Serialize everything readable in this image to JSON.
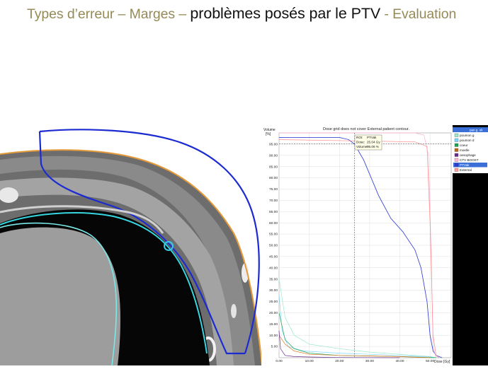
{
  "slide": {
    "title_prefix": "Types d’erreur – Marges – ",
    "title_main": "problèmes posés par le PTV",
    "title_suffix": " - Evaluation"
  },
  "dvh_window": {
    "warning": "Dose grid does not cover External patient contour.",
    "ylabel_line1": "Volume",
    "ylabel_line2": "[%]",
    "xlabel": "Dose [Gy]",
    "tooltip": {
      "roi_label": "ROI:",
      "roi_value": "PTVak",
      "dose_label": "Dose:",
      "dose_value": "25.04 Gy",
      "volume_label": "Volume:",
      "volume_value": "95.06 %"
    },
    "legend_header": "pan g. ok",
    "legend": [
      {
        "name": "poumon g",
        "color": "#9be9c9"
      },
      {
        "name": "poumon d",
        "color": "#7fd7ff"
      },
      {
        "name": "coeur",
        "color": "#22a055"
      },
      {
        "name": "moelle",
        "color": "#b36b18"
      },
      {
        "name": "oesophage",
        "color": "#6a2a8a"
      },
      {
        "name": "CTV BOOST",
        "color": "#ffb6d9"
      },
      {
        "name": "PTVak",
        "color": "#2a3be0",
        "selected": true
      },
      {
        "name": "External",
        "color": "#ff9e9e"
      }
    ]
  },
  "chart_data": {
    "type": "line",
    "xlabel": "Dose [Gy]",
    "ylabel": "Volume [%]",
    "xlim": [
      0,
      57
    ],
    "ylim": [
      0,
      100
    ],
    "x_ticks": [
      "0.00",
      "10.00",
      "20.00",
      "30.00",
      "40.00",
      "50.00"
    ],
    "y_ticks": [
      "5.00",
      "10.00",
      "15.00",
      "20.00",
      "25.00",
      "30.00",
      "35.00",
      "40.00",
      "45.00",
      "50.00",
      "55.00",
      "60.00",
      "65.00",
      "70.00",
      "75.00",
      "80.00",
      "85.00",
      "90.00",
      "95.00"
    ],
    "series": [
      {
        "name": "PTVak",
        "color": "#3a48d8",
        "x": [
          0,
          20,
          23,
          25,
          28,
          33,
          37,
          41,
          45,
          47,
          49,
          50,
          51,
          52,
          54
        ],
        "y": [
          98,
          98,
          97,
          95,
          88,
          72,
          62,
          56,
          48,
          40,
          25,
          10,
          3,
          1,
          0
        ]
      },
      {
        "name": "CTV BOOST",
        "color": "#ffb0d0",
        "x": [
          0,
          45,
          48,
          49.5,
          50.5,
          51,
          52
        ],
        "y": [
          100,
          100,
          99,
          90,
          40,
          5,
          0
        ]
      },
      {
        "name": "External",
        "color": "#ff8a8a",
        "x": [
          0,
          45,
          49,
          50,
          51,
          52,
          53
        ],
        "y": [
          97,
          96,
          94,
          60,
          10,
          1,
          0
        ]
      },
      {
        "name": "poumon g",
        "color": "#9be9c9",
        "x": [
          0,
          2,
          5,
          10,
          20,
          30,
          40,
          50,
          52
        ],
        "y": [
          35,
          18,
          10,
          6,
          4,
          2.5,
          1.5,
          0.5,
          0
        ]
      },
      {
        "name": "poumon d",
        "color": "#7fd7ff",
        "x": [
          0,
          1,
          3,
          8,
          20,
          30,
          40,
          50,
          52
        ],
        "y": [
          28,
          12,
          5,
          3,
          2,
          1.5,
          1,
          0.3,
          0
        ]
      },
      {
        "name": "coeur",
        "color": "#22a055",
        "x": [
          0,
          2,
          5,
          10,
          20,
          40,
          52
        ],
        "y": [
          20,
          8,
          4,
          2,
          1,
          0.5,
          0
        ]
      },
      {
        "name": "moelle",
        "color": "#e07a22",
        "x": [
          0,
          2,
          5,
          10,
          20,
          30,
          40,
          45,
          50
        ],
        "y": [
          10,
          6,
          3,
          1.5,
          1,
          0.8,
          0.5,
          0.2,
          0
        ]
      },
      {
        "name": "oesophage",
        "color": "#6a2a8a",
        "x": [
          0,
          0.5,
          2,
          5,
          10,
          20,
          40
        ],
        "y": [
          12,
          4,
          1,
          0.5,
          0.3,
          0.1,
          0
        ]
      }
    ],
    "crosshair": {
      "x": 25.04,
      "y": 95.06
    },
    "grid": true,
    "legend_position": "right"
  }
}
